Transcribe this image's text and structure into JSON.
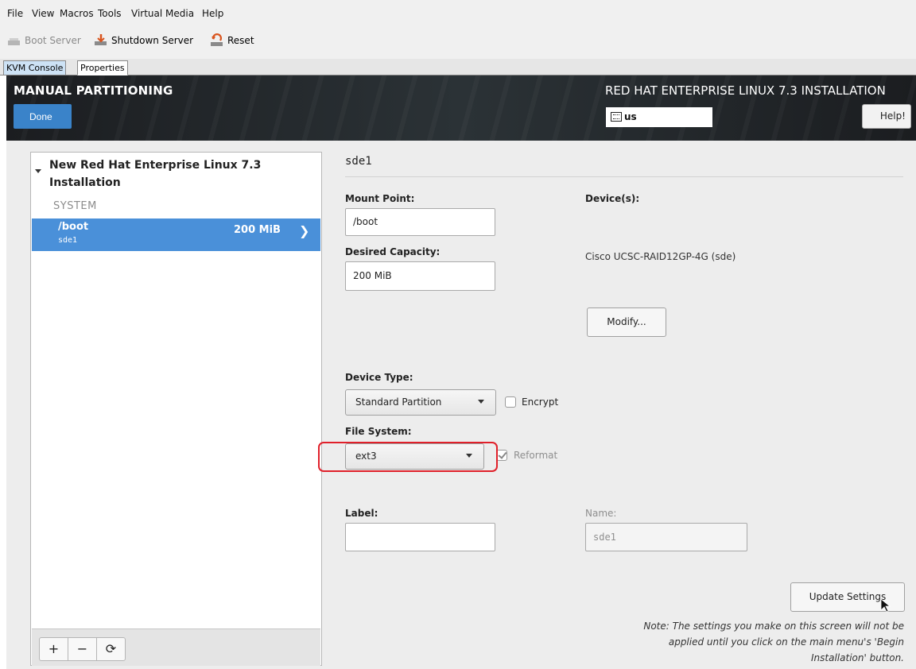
{
  "menu": {
    "items": [
      "File",
      "View",
      "Macros",
      "Tools",
      "Virtual Media",
      "Help"
    ]
  },
  "toolbar": {
    "boot_server": "Boot Server",
    "shutdown_server": "Shutdown Server",
    "reset": "Reset"
  },
  "tabs": [
    "KVM Console",
    "Properties"
  ],
  "header": {
    "title": "MANUAL PARTITIONING",
    "done_label": "Done",
    "product_title": "RED HAT ENTERPRISE LINUX 7.3 INSTALLATION",
    "keyboard_layout": "us",
    "help_label": "Help!"
  },
  "left_panel": {
    "install_title": "New Red Hat Enterprise Linux 7.3 Installation",
    "section_label": "SYSTEM",
    "partitions": [
      {
        "mount": "/boot",
        "device": "sde1",
        "size": "200 MiB"
      }
    ],
    "add_label": "+",
    "remove_label": "−",
    "refresh_label": "⟳"
  },
  "detail": {
    "partition_name": "sde1",
    "mount_point_label": "Mount Point:",
    "mount_point_value": "/boot",
    "desired_capacity_label": "Desired Capacity:",
    "desired_capacity_value": "200 MiB",
    "devices_label": "Device(s):",
    "device_value": "Cisco UCSC-RAID12GP-4G (sde)",
    "modify_label": "Modify...",
    "device_type_label": "Device Type:",
    "device_type_value": "Standard Partition",
    "encrypt_label": "Encrypt",
    "encrypt_checked": false,
    "file_system_label": "File System:",
    "file_system_value": "ext3",
    "reformat_label": "Reformat",
    "reformat_checked": true,
    "label_label": "Label:",
    "label_value": "",
    "name_label": "Name:",
    "name_value": "sde1",
    "update_settings_label": "Update Settings",
    "note_text": "Note:  The settings you make on this screen will not be applied until you click on the main menu's 'Begin Installation' button."
  },
  "colors": {
    "accent": "#4a90d9",
    "done_button": "#3a83c9",
    "highlight": "#e0202a"
  }
}
